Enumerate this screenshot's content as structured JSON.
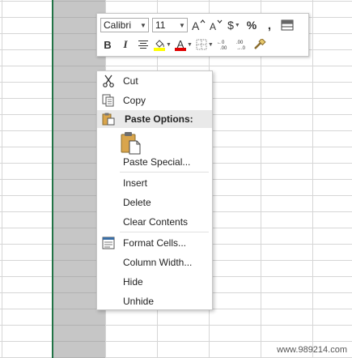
{
  "mini_toolbar": {
    "font_name": "Calibri",
    "font_size": "11",
    "bold": "B",
    "italic": "I",
    "font_color_letter": "A",
    "percent": "%",
    "comma": ",",
    "currency": "$"
  },
  "context_menu": {
    "cut": "Cut",
    "copy": "Copy",
    "paste_options": "Paste Options:",
    "paste_special": "Paste Special...",
    "insert": "Insert",
    "delete": "Delete",
    "clear_contents": "Clear Contents",
    "format_cells": "Format Cells...",
    "column_width": "Column Width...",
    "hide": "Hide",
    "unhide": "Unhide"
  },
  "colors": {
    "selection_border": "#217346",
    "selected_column": "#c6c6c6",
    "fill_color": "#ffff00",
    "font_color": "#e00000"
  },
  "watermark": "www.989214.com"
}
